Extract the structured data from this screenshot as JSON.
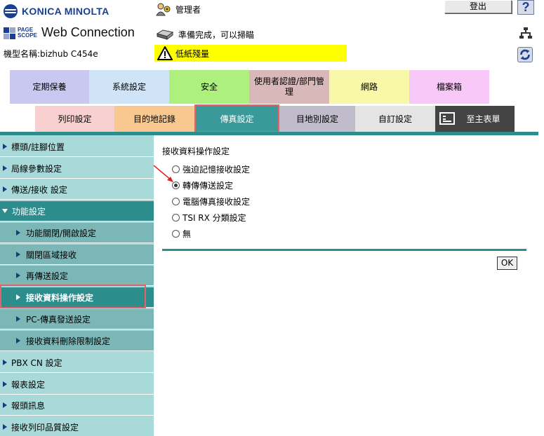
{
  "header": {
    "brand": "KONICA MINOLTA",
    "pagescope_label_1": "PAGE",
    "pagescope_label_2": "SCOPE",
    "product": "Web Connection",
    "model": "機型名稱:bizhub C454e",
    "user": "管理者",
    "status": "準備完成，可以掃瞄",
    "warning": "低紙殘量",
    "logout": "登出",
    "help": "?"
  },
  "tabs_row1": [
    {
      "label": "定期保養",
      "color": "#c8c8f0"
    },
    {
      "label": "系統設定",
      "color": "#d0e4f8"
    },
    {
      "label": "安全",
      "color": "#aef07e"
    },
    {
      "label": "使用者認證/部門管理",
      "color": "#d8b8b8"
    },
    {
      "label": "網路",
      "color": "#f8f8a8"
    },
    {
      "label": "檔案箱",
      "color": "#f8c8f8"
    }
  ],
  "tabs_row2": [
    {
      "label": "列印設定",
      "color": "#f8d0d0"
    },
    {
      "label": "目的地記錄",
      "color": "#f8c890"
    },
    {
      "label": "傳真設定",
      "color": "#3a9a9a"
    },
    {
      "label": "目地別設定",
      "color": "#c0bccc"
    },
    {
      "label": "自訂設定",
      "color": "#e4e4e4"
    },
    {
      "label": "至主表單",
      "color": "#444444"
    }
  ],
  "sidebar": [
    {
      "label": "標頭/註腳位置"
    },
    {
      "label": "局線參數設定"
    },
    {
      "label": "傳送/接收 設定"
    },
    {
      "label": "功能設定"
    },
    {
      "label": "功能關閉/開啟設定"
    },
    {
      "label": "關閉區域接收"
    },
    {
      "label": "再傳送設定"
    },
    {
      "label": "接收資料操作設定"
    },
    {
      "label": "PC-傳真發送設定"
    },
    {
      "label": "接收資料刪除限制設定"
    },
    {
      "label": "PBX CN 設定"
    },
    {
      "label": "報表設定"
    },
    {
      "label": "報頭訊息"
    },
    {
      "label": "接收列印品質設定"
    }
  ],
  "content": {
    "title": "接收資料操作設定",
    "options": [
      {
        "label": "強迫記憶接收設定",
        "checked": false
      },
      {
        "label": "轉傳傳送設定",
        "checked": true
      },
      {
        "label": "電腦傳真接收設定",
        "checked": false
      },
      {
        "label": "TSI RX 分類設定",
        "checked": false
      },
      {
        "label": "無",
        "checked": false
      }
    ],
    "ok": "OK"
  }
}
